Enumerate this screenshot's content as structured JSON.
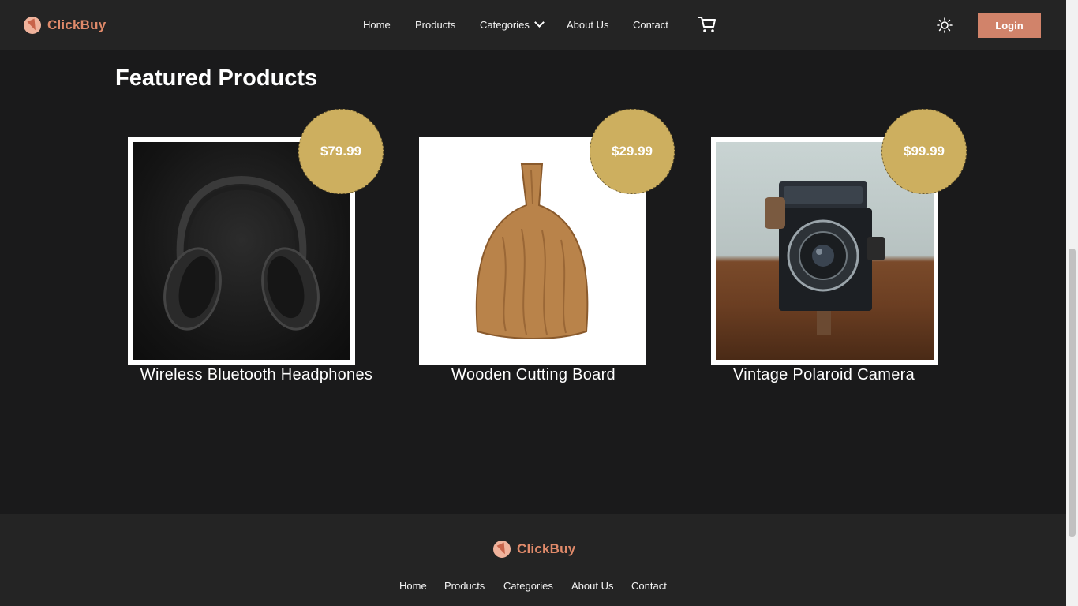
{
  "app": {
    "brand": "ClickBuy"
  },
  "nav": {
    "items": [
      {
        "label": "Home"
      },
      {
        "label": "Products"
      },
      {
        "label": "Categories"
      },
      {
        "label": "About Us"
      },
      {
        "label": "Contact"
      }
    ],
    "login_label": "Login",
    "icons": [
      "cart-icon",
      "sun-icon",
      "chevron-down-icon"
    ]
  },
  "featured": {
    "title": "Featured Products",
    "products": [
      {
        "name": "Wireless Bluetooth Headphones",
        "price": "$79.99"
      },
      {
        "name": "Wooden Cutting Board",
        "price": "$29.99"
      },
      {
        "name": "Vintage Polaroid Camera",
        "price": "$99.99"
      }
    ]
  },
  "footer": {
    "brand": "ClickBuy",
    "links": [
      {
        "label": "Home"
      },
      {
        "label": "Products"
      },
      {
        "label": "Categories"
      },
      {
        "label": "About Us"
      },
      {
        "label": "Contact"
      }
    ]
  },
  "colors": {
    "accent": "#d1836a",
    "brand_text": "#e08a6a",
    "price_badge": "#cdaf5f",
    "background": "#1a1a1b",
    "navbar": "#242424"
  }
}
